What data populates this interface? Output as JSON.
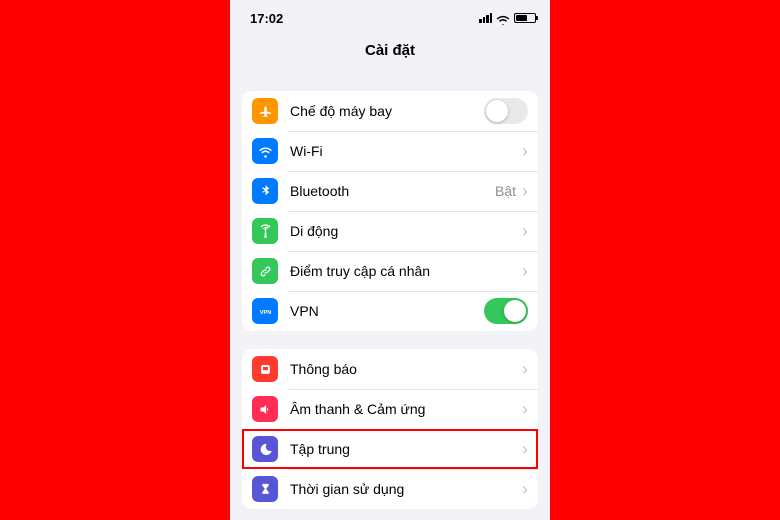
{
  "status": {
    "time": "17:02"
  },
  "header": {
    "title": "Cài đặt"
  },
  "groups": [
    {
      "rows": [
        {
          "id": "airplane",
          "label": "Chế độ máy bay",
          "icon_bg": "#ff9500",
          "icon": "airplane",
          "control": "toggle",
          "on": false
        },
        {
          "id": "wifi",
          "label": "Wi-Fi",
          "icon_bg": "#007aff",
          "icon": "wifi",
          "control": "chevron",
          "detail": ""
        },
        {
          "id": "bluetooth",
          "label": "Bluetooth",
          "icon_bg": "#007aff",
          "icon": "bluetooth",
          "control": "chevron",
          "detail": "Bật"
        },
        {
          "id": "cellular",
          "label": "Di động",
          "icon_bg": "#34c759",
          "icon": "antenna",
          "control": "chevron",
          "detail": ""
        },
        {
          "id": "hotspot",
          "label": "Điểm truy cập cá nhân",
          "icon_bg": "#34c759",
          "icon": "link",
          "control": "chevron",
          "detail": ""
        },
        {
          "id": "vpn",
          "label": "VPN",
          "icon_bg": "#007aff",
          "icon": "vpn",
          "control": "toggle",
          "on": true
        }
      ]
    },
    {
      "rows": [
        {
          "id": "notifications",
          "label": "Thông báo",
          "icon_bg": "#ff3b30",
          "icon": "bell",
          "control": "chevron",
          "detail": ""
        },
        {
          "id": "sounds",
          "label": "Âm thanh & Cảm ứng",
          "icon_bg": "#ff2d55",
          "icon": "speaker",
          "control": "chevron",
          "detail": ""
        },
        {
          "id": "focus",
          "label": "Tập trung",
          "icon_bg": "#5856d6",
          "icon": "moon",
          "control": "chevron",
          "detail": "",
          "highlighted": true
        },
        {
          "id": "screentime",
          "label": "Thời gian sử dụng",
          "icon_bg": "#5856d6",
          "icon": "hourglass",
          "control": "chevron",
          "detail": ""
        }
      ]
    }
  ]
}
